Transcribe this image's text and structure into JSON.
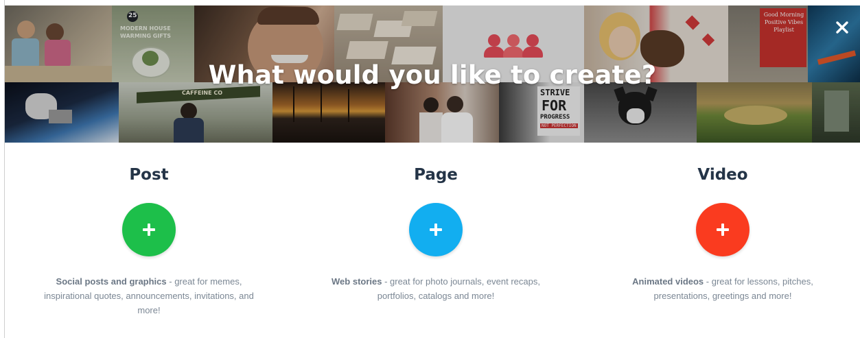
{
  "header": {
    "title": "What would you like to create?",
    "close_label": "✕",
    "tiles": {
      "gift_number": "25",
      "gift_caption": "MODERN HOUSE WARMING GIFTS",
      "playlist_text": "Good Morning Positive Vibes Playlist",
      "strive_1": "STRIVE",
      "strive_2": "FOR",
      "strive_3": "PROGRESS",
      "strive_4": "NOT PERFECTION",
      "booth_sign": "CAFFEINE CO"
    }
  },
  "options": [
    {
      "title": "Post",
      "color": "#1dbf4a",
      "desc_bold": "Social posts and graphics",
      "desc_rest": " - great for memes, inspirational quotes, announcements, invitations, and more!"
    },
    {
      "title": "Page",
      "color": "#12aef0",
      "desc_bold": "Web stories",
      "desc_rest": " - great for photo journals, event recaps, portfolios, catalogs and more!"
    },
    {
      "title": "Video",
      "color": "#fa3b1f",
      "desc_bold": "Animated videos",
      "desc_rest": " - great for lessons, pitches, presentations, greetings and more!"
    }
  ]
}
